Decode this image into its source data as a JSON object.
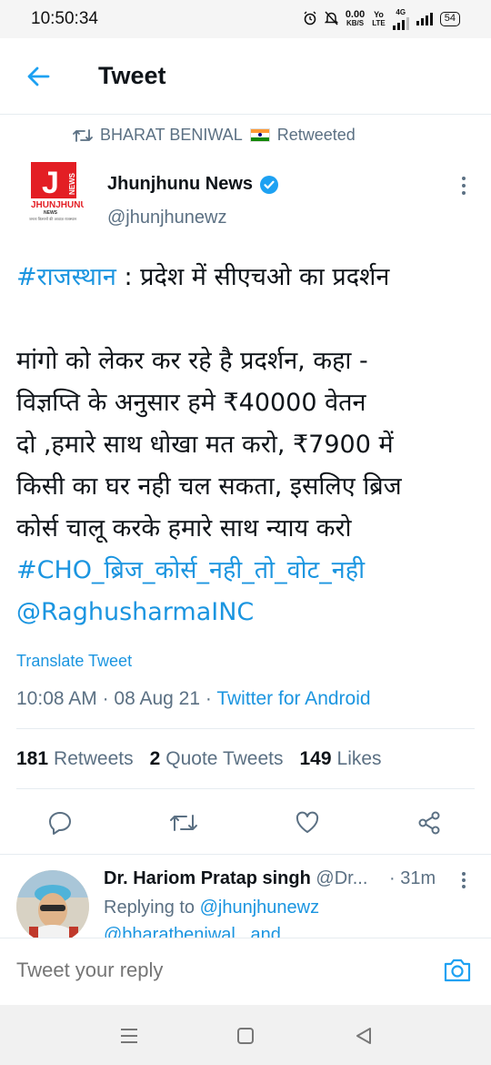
{
  "status_bar": {
    "time": "10:50:34",
    "speed_value": "0.00",
    "speed_unit": "KB/S",
    "volte_top": "Yo",
    "volte_bottom": "LTE",
    "network": "4G",
    "battery": "54"
  },
  "header": {
    "back_icon": "arrow-left-icon",
    "title": "Tweet"
  },
  "retweet": {
    "icon": "retweet-icon",
    "user": "BHARAT BENIWAL",
    "flag": "india-flag",
    "label": "Retweeted"
  },
  "author": {
    "name": "Jhunjhunu News",
    "handle": "@jhunjhunewz",
    "verified_icon": "verified-badge-icon",
    "avatar_logo_letter": "J",
    "avatar_logo_side": "NEWS",
    "avatar_caption": "JHUNJHUNU",
    "avatar_caption_sub": "NEWS",
    "avatar_tagline": "जनता किसानों की आवाज़ राजस्थान"
  },
  "tweet": {
    "hashtag1": "#राजस्थान",
    "line1_rest": " : प्रदेश में सीएचओ का प्रदर्शन",
    "lines": [
      "मांगो को लेकर कर रहे है प्रदर्शन, कहा -",
      "विज्ञप्ति के अनुसार हमे ₹40000 वेतन",
      "दो ,हमारे साथ धोखा मत करो, ₹7900 में",
      "किसी का घर नही चल सकता, इसलिए ब्रिज",
      "कोर्स चालू करके हमारे साथ न्याय करो"
    ],
    "hashtag2": "#CHO_ब्रिज_कोर्स_नही_तो_वोट_नही",
    "mention": "@RaghusharmaINC",
    "translate": "Translate Tweet",
    "time": "10:08 AM",
    "date": "08 Aug 21",
    "source": "Twitter for Android",
    "separator": "·"
  },
  "stats": {
    "retweets_count": "181",
    "retweets_label": "Retweets",
    "quotes_count": "2",
    "quotes_label": "Quote Tweets",
    "likes_count": "149",
    "likes_label": "Likes"
  },
  "actions": [
    "reply-icon",
    "retweet-icon",
    "like-heart-icon",
    "share-icon"
  ],
  "reply": {
    "name": "Dr. Hariom Pratap singh",
    "handle": "@Dr...",
    "time": "· 31m",
    "replying_label": "Replying to",
    "replying_to": "@jhunjhunewz",
    "replying_more": "@bharatbeniwal_ and"
  },
  "compose": {
    "placeholder": "Tweet your reply",
    "camera_icon": "camera-icon"
  },
  "nav": [
    "menu-icon",
    "home-square-icon",
    "back-triangle-icon"
  ],
  "colors": {
    "accent": "#1b95e0",
    "muted": "#5b7083",
    "logo_red": "#e31e24"
  }
}
